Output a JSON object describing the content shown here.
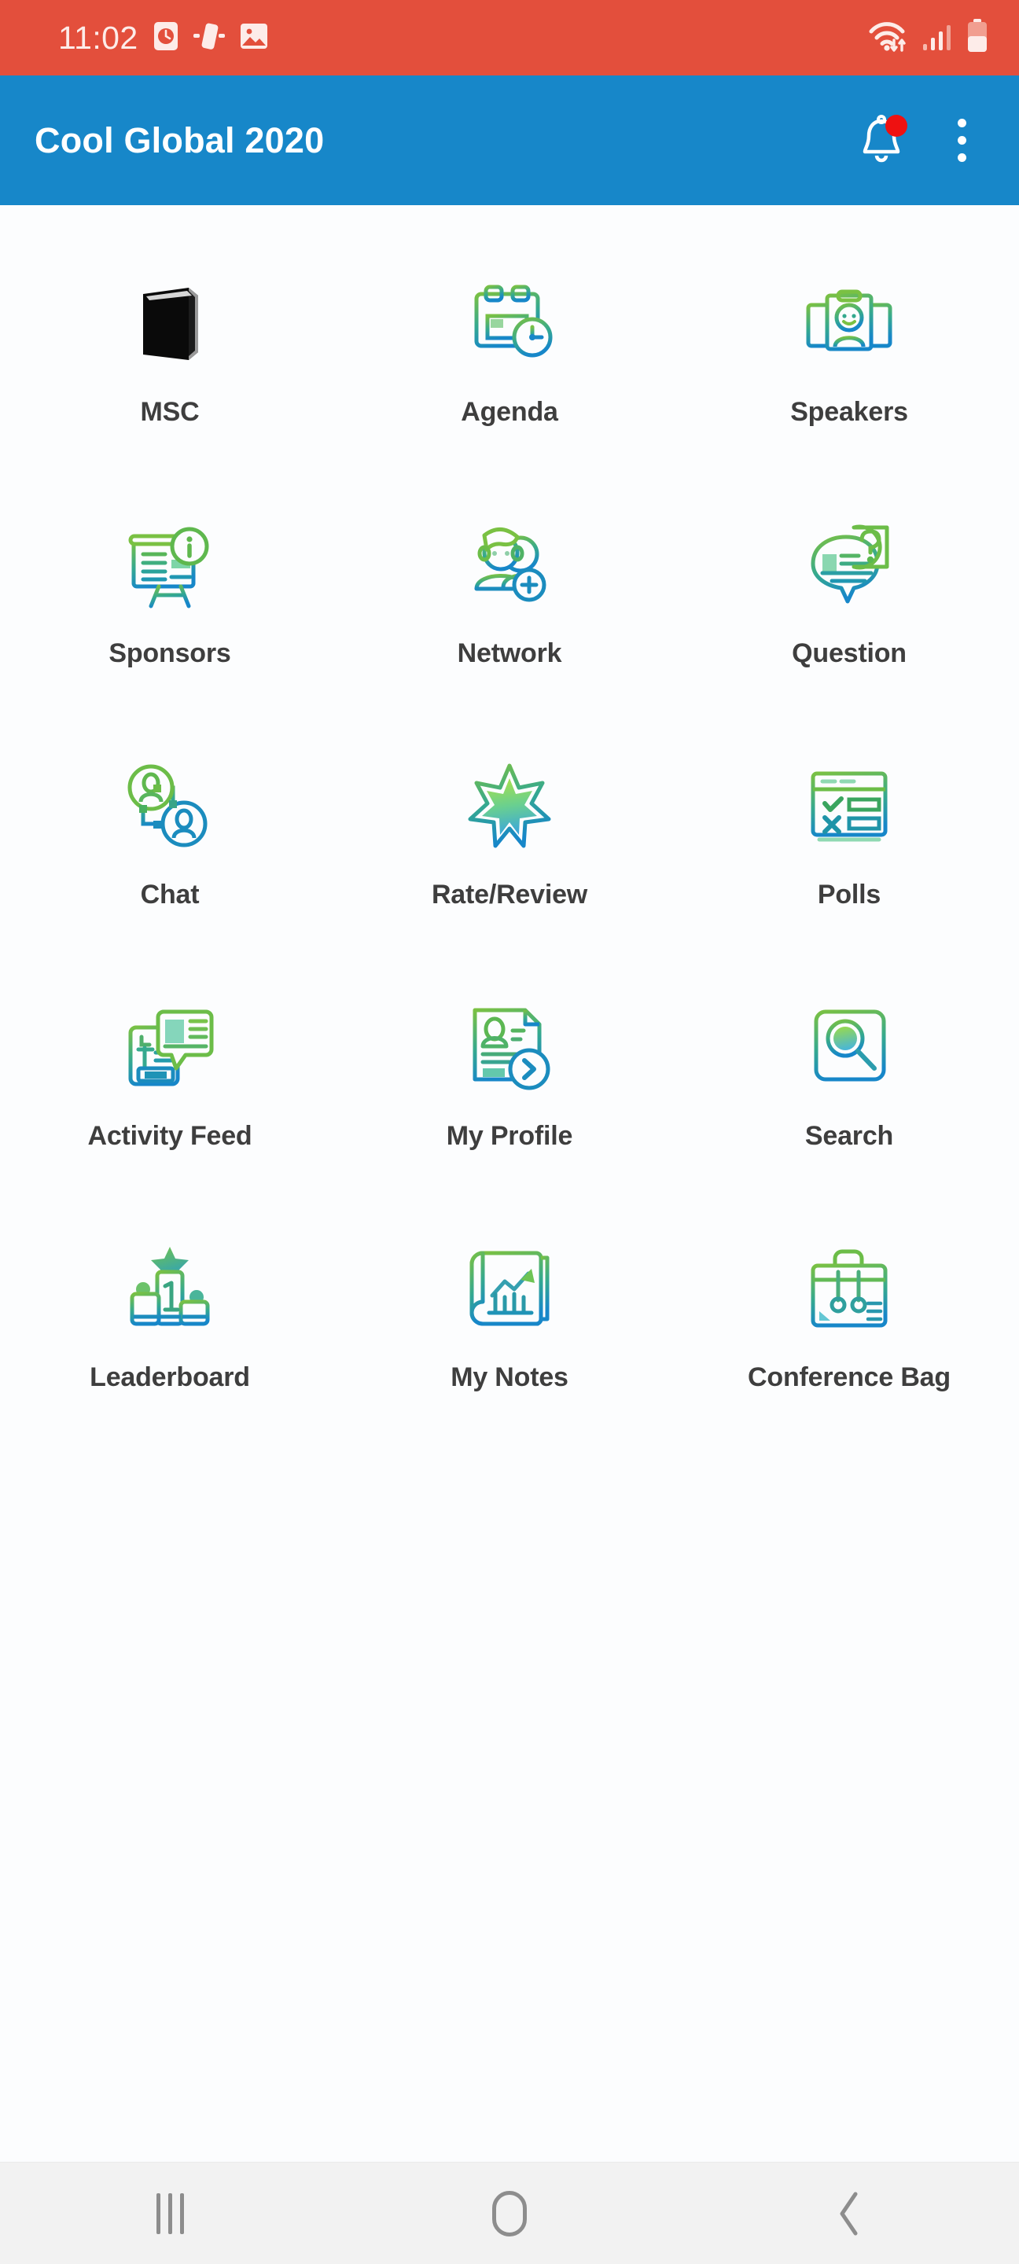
{
  "status_bar": {
    "time": "11:02",
    "left_icons": [
      "alarm-clock-icon",
      "screen-rotation-icon",
      "gallery-image-icon"
    ],
    "right_icons": [
      "wifi-transfer-icon",
      "cellular-signal-icon",
      "battery-icon"
    ],
    "background_color": "#e34f3c",
    "foreground_color": "#fdece9"
  },
  "app_bar": {
    "title": "Cool Global 2020",
    "background_color": "#1787c9",
    "title_color": "#ffffff",
    "notification_icon": "notification-bell-icon",
    "notification_badge_color": "#ee1111",
    "overflow_icon": "overflow-menu-icon"
  },
  "theme": {
    "gradient_start": "#7ac143",
    "gradient_mid": "#3fae7f",
    "gradient_end": "#1787c9",
    "label_color": "#3e3e3e",
    "page_background": "#fcfdfe"
  },
  "grid": {
    "columns": 3,
    "items": [
      {
        "label": "MSC",
        "icon": "book-icon"
      },
      {
        "label": "Agenda",
        "icon": "calendar-clock-icon"
      },
      {
        "label": "Speakers",
        "icon": "speaker-cards-icon"
      },
      {
        "label": "Sponsors",
        "icon": "presentation-board-info-icon"
      },
      {
        "label": "Network",
        "icon": "people-add-icon"
      },
      {
        "label": "Question",
        "icon": "question-bubble-icon"
      },
      {
        "label": "Chat",
        "icon": "connected-users-icon"
      },
      {
        "label": "Rate/Review",
        "icon": "star-icon"
      },
      {
        "label": "Polls",
        "icon": "poll-window-icon"
      },
      {
        "label": "Activity Feed",
        "icon": "activity-feed-icon"
      },
      {
        "label": "My Profile",
        "icon": "profile-document-icon"
      },
      {
        "label": "Search",
        "icon": "search-square-icon"
      },
      {
        "label": "Leaderboard",
        "icon": "podium-icon"
      },
      {
        "label": "My Notes",
        "icon": "notes-chart-icon"
      },
      {
        "label": "Conference Bag",
        "icon": "tote-bag-icon"
      }
    ]
  },
  "nav_bar": {
    "background_color": "#f2f2f2",
    "buttons": [
      {
        "name": "recents-button",
        "icon": "recents-icon"
      },
      {
        "name": "home-button",
        "icon": "home-icon"
      },
      {
        "name": "back-button",
        "icon": "back-chevron-icon"
      }
    ]
  }
}
